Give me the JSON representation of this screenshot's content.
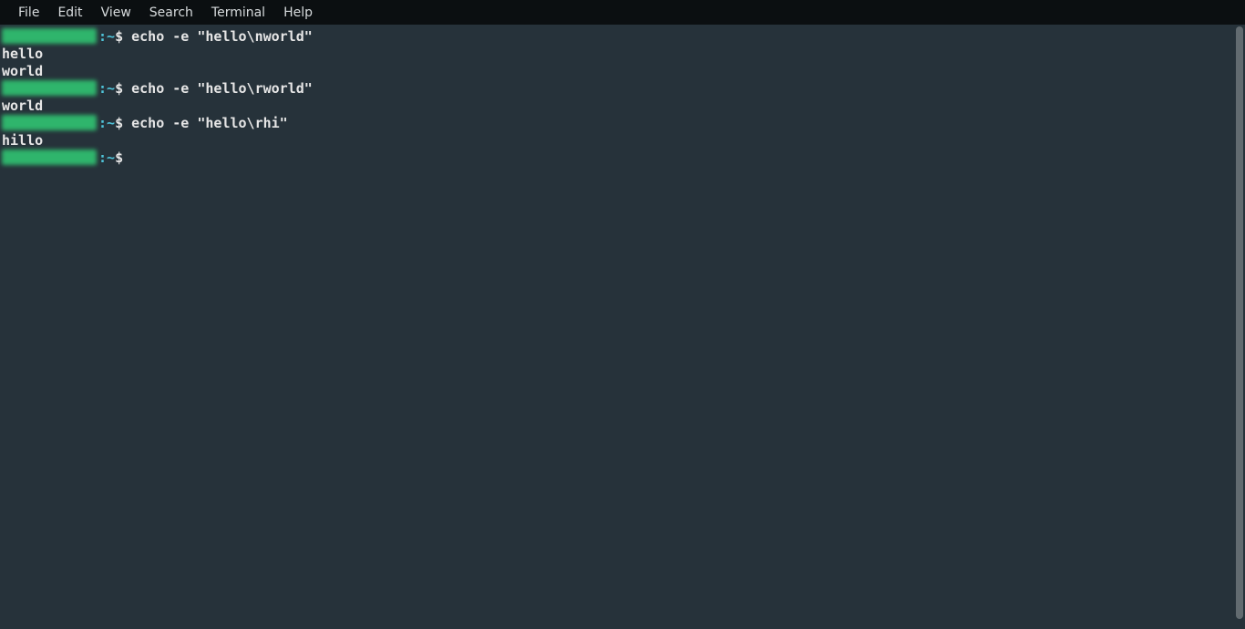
{
  "menubar": {
    "items": [
      "File",
      "Edit",
      "View",
      "Search",
      "Terminal",
      "Help"
    ]
  },
  "colors": {
    "bg": "#26323a",
    "menubar_bg": "#0b0f11",
    "prompt_user": "#2fb56c",
    "prompt_path": "#4fc3d9",
    "text": "#e6e6e6",
    "scrollbar_thumb": "#626b70"
  },
  "session": {
    "prompt_sep": ":",
    "prompt_path": "~",
    "prompt_symbol": "$",
    "entries": [
      {
        "command": "echo -e \"hello\\nworld\"",
        "output_lines": [
          "hello",
          "world"
        ]
      },
      {
        "command": "echo -e \"hello\\rworld\"",
        "output_lines": [
          "world"
        ]
      },
      {
        "command": "echo -e \"hello\\rhi\"",
        "output_lines": [
          "hillo"
        ]
      }
    ],
    "trailing_prompt": true
  }
}
